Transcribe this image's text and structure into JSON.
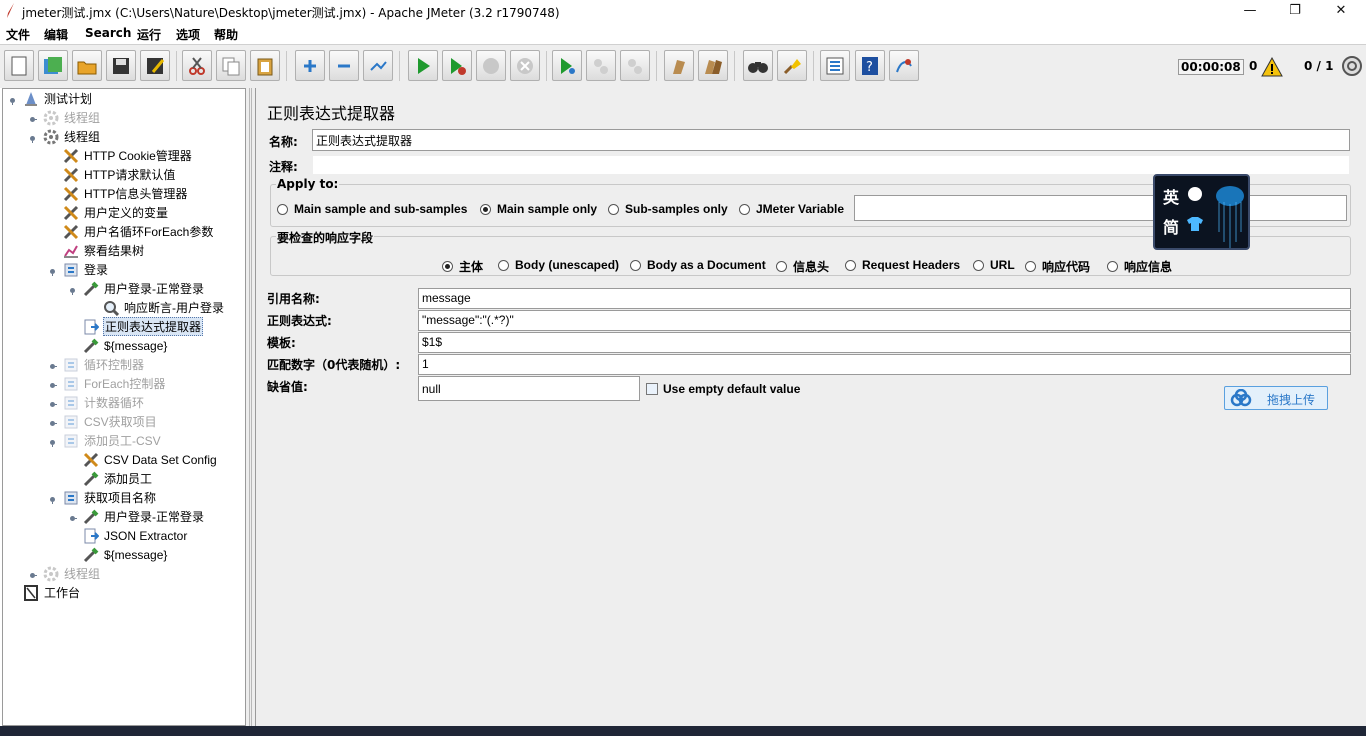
{
  "window": {
    "title": "jmeter测试.jmx (C:\\Users\\Nature\\Desktop\\jmeter测试.jmx) - Apache JMeter (3.2 r1790748)",
    "minimize": "—",
    "restore": "❐",
    "close": "✕"
  },
  "menu": [
    "文件",
    "编辑",
    "Search",
    "运行",
    "选项",
    "帮助"
  ],
  "toolbar": {
    "buttons": [
      "new-icon",
      "templates-icon",
      "open-icon",
      "save-icon",
      "save-as-icon",
      "cut-icon",
      "copy-icon",
      "paste-icon",
      "expand-icon",
      "collapse-icon",
      "toggle-icon",
      "start-icon",
      "start-no-pauses-icon",
      "stop-icon",
      "shutdown-icon",
      "remote-start-icon",
      "remote-stop-icon",
      "remote-shutdown-icon",
      "clear-icon",
      "clear-all-icon",
      "search-icon",
      "reset-search-icon",
      "function-helper-icon",
      "help-icon",
      "logger-icon"
    ],
    "timer": "00:00:08",
    "error_count": "0",
    "threads": "0 / 1"
  },
  "tree": [
    {
      "label": "测试计划",
      "icon": "testplan-icon",
      "disabled": false
    },
    {
      "label": "线程组",
      "icon": "threadgroup-icon",
      "disabled": true
    },
    {
      "label": "线程组",
      "icon": "threadgroup-icon",
      "disabled": false
    },
    {
      "label": "HTTP Cookie管理器",
      "icon": "config-icon",
      "disabled": false
    },
    {
      "label": "HTTP请求默认值",
      "icon": "config-icon",
      "disabled": false
    },
    {
      "label": "HTTP信息头管理器",
      "icon": "config-icon",
      "disabled": false
    },
    {
      "label": "用户定义的变量",
      "icon": "config-icon",
      "disabled": false
    },
    {
      "label": "用户名循环ForEach参数",
      "icon": "config-icon",
      "disabled": false
    },
    {
      "label": "察看结果树",
      "icon": "listener-icon",
      "disabled": false
    },
    {
      "label": "登录",
      "icon": "controller-icon",
      "disabled": false
    },
    {
      "label": "用户登录-正常登录",
      "icon": "sampler-icon",
      "disabled": false
    },
    {
      "label": "响应断言-用户登录",
      "icon": "assertion-icon",
      "disabled": false
    },
    {
      "label": "正则表达式提取器",
      "icon": "postprocessor-icon",
      "disabled": false,
      "selected": true
    },
    {
      "label": "${message}",
      "icon": "sampler-icon",
      "disabled": false
    },
    {
      "label": "循环控制器",
      "icon": "controller-icon",
      "disabled": true
    },
    {
      "label": "ForEach控制器",
      "icon": "controller-icon",
      "disabled": true
    },
    {
      "label": "计数器循环",
      "icon": "controller-icon",
      "disabled": true
    },
    {
      "label": "CSV获取项目",
      "icon": "controller-icon",
      "disabled": true
    },
    {
      "label": "添加员工-CSV",
      "icon": "controller-icon",
      "disabled": true
    },
    {
      "label": "CSV Data Set Config",
      "icon": "config-icon",
      "disabled": false
    },
    {
      "label": "添加员工",
      "icon": "sampler-icon",
      "disabled": false
    },
    {
      "label": "获取项目名称",
      "icon": "controller-icon",
      "disabled": false
    },
    {
      "label": "用户登录-正常登录",
      "icon": "sampler-icon",
      "disabled": false
    },
    {
      "label": "JSON Extractor",
      "icon": "postprocessor-icon",
      "disabled": false
    },
    {
      "label": "${message}",
      "icon": "sampler-icon",
      "disabled": false
    },
    {
      "label": "线程组",
      "icon": "threadgroup-icon",
      "disabled": true
    },
    {
      "label": "工作台",
      "icon": "workbench-icon",
      "disabled": false
    }
  ],
  "panel": {
    "title": "正则表达式提取器",
    "name_label": "名称:",
    "name_value": "正则表达式提取器",
    "comment_label": "注释:",
    "comment_value": "",
    "apply_to": {
      "title": "Apply to:",
      "options": [
        "Main sample and sub-samples",
        "Main sample only",
        "Sub-samples only",
        "JMeter Variable"
      ],
      "selected": "Main sample only",
      "variable_value": ""
    },
    "field_to_check": {
      "title": "要检查的响应字段",
      "options": [
        "主体",
        "Body (unescaped)",
        "Body as a Document",
        "信息头",
        "Request Headers",
        "URL",
        "响应代码",
        "响应信息"
      ],
      "selected": "主体"
    },
    "ref_name_label": "引用名称:",
    "ref_name_value": "message",
    "regex_label": "正则表达式:",
    "regex_value": "\"message\":\"(.*?)\"",
    "template_label": "模板:",
    "template_value": "$1$",
    "match_no_label": "匹配数字（0代表随机）:",
    "match_no_value": "1",
    "default_label": "缺省值:",
    "default_value": "null",
    "use_empty_label": "Use empty default value",
    "use_empty_checked": false
  },
  "ime": {
    "line1": "英",
    "line2": "简"
  },
  "upload": {
    "label": "拖拽上传"
  }
}
